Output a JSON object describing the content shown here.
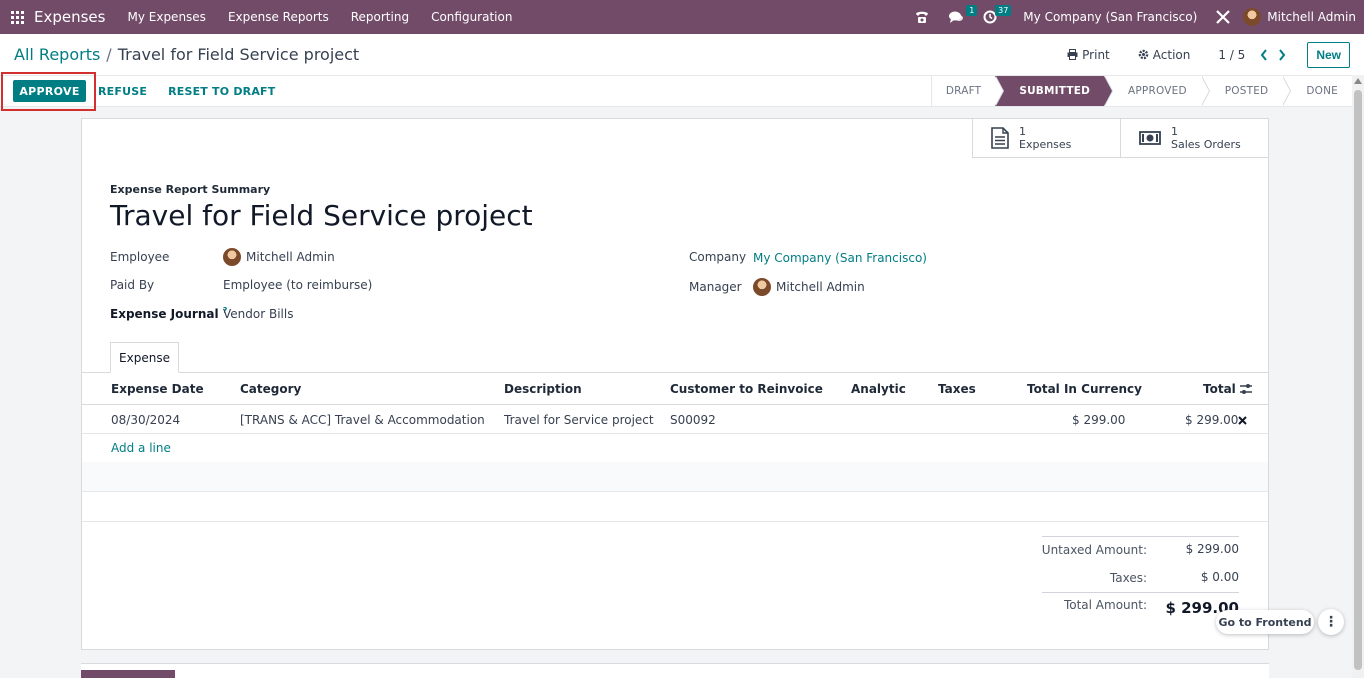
{
  "navbar": {
    "app_name": "Expenses",
    "menu": [
      "My Expenses",
      "Expense Reports",
      "Reporting",
      "Configuration"
    ],
    "messages_count": "1",
    "activities_count": "37",
    "company": "My Company (San Francisco)",
    "user": "Mitchell Admin"
  },
  "breadcrumb": {
    "parent": "All Reports",
    "separator": "/",
    "current": "Travel for Field Service project"
  },
  "control": {
    "print": "Print",
    "action": "Action",
    "pager": "1 / 5",
    "new": "New"
  },
  "statusbar": {
    "approve": "APPROVE",
    "refuse": "REFUSE",
    "reset": "RESET TO DRAFT",
    "stages": [
      "DRAFT",
      "SUBMITTED",
      "APPROVED",
      "POSTED",
      "DONE"
    ],
    "active_stage": "SUBMITTED"
  },
  "smart_buttons": [
    {
      "count": "1",
      "label": "Expenses",
      "icon": "document-icon"
    },
    {
      "count": "1",
      "label": "Sales Orders",
      "icon": "money-icon"
    }
  ],
  "form": {
    "summary_label": "Expense Report Summary",
    "title": "Travel for Field Service project",
    "employee_label": "Employee",
    "employee": "Mitchell Admin",
    "paid_by_label": "Paid By",
    "paid_by": "Employee (to reimburse)",
    "journal_label": "Expense Journal",
    "journal_help": "?",
    "journal": "Vendor Bills",
    "company_label": "Company",
    "company": "My Company (San Francisco)",
    "manager_label": "Manager",
    "manager": "Mitchell Admin"
  },
  "tab": "Expense",
  "table": {
    "headers": [
      "Expense Date",
      "Category",
      "Description",
      "Customer to Reinvoice",
      "Analytic",
      "Taxes",
      "Total In Currency",
      "Total"
    ],
    "rows": [
      {
        "date": "08/30/2024",
        "category": "[TRANS & ACC] Travel & Accommodation",
        "description": "Travel for Service project",
        "customer": "S00092",
        "analytic": "",
        "taxes": "",
        "total_currency": "$ 299.00",
        "total": "$ 299.00"
      }
    ],
    "add_line": "Add a line"
  },
  "totals": {
    "untaxed_label": "Untaxed Amount:",
    "untaxed": "$ 299.00",
    "taxes_label": "Taxes:",
    "taxes": "$ 0.00",
    "total_label": "Total Amount:",
    "total": "$ 299.00"
  },
  "floating": {
    "frontend": "Go to Frontend",
    "more": "⋮"
  },
  "colors": {
    "brand": "#714b67",
    "accent": "#017e84",
    "highlight": "#d32f2f"
  }
}
